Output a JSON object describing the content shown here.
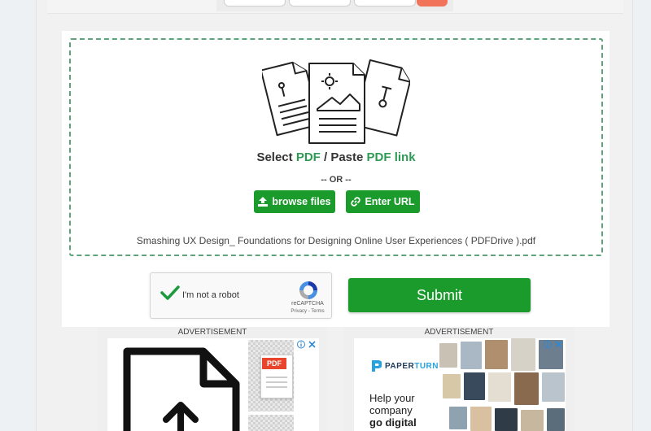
{
  "upload": {
    "title_select": "Select",
    "title_pdf1": "PDF",
    "title_sep": "/ Paste",
    "title_pdf2": "PDF link",
    "or_text": "-- OR --",
    "browse_label": "browse files",
    "url_label": "Enter URL",
    "filename": "Smashing UX Design_ Foundations for Designing Online User Experiences ( PDFDrive ).pdf"
  },
  "captcha": {
    "label": "I'm not a robot",
    "brand": "reCAPTCHA",
    "links": "Privacy - Terms"
  },
  "submit_label": "Submit",
  "ads": {
    "left_label": "ADVERTISEMENT",
    "right_label": "ADVERTISEMENT",
    "left_pdf_badge": "PDF",
    "right_brand_main": "PAPER",
    "right_brand_accent": "TURN",
    "right_tag_line1": "Help your",
    "right_tag_line2": "company",
    "right_tag_line3": "go digital"
  },
  "colors": {
    "accent_green": "#1a9b2c",
    "link_green": "#2e9a54",
    "dashed_border": "#5fa37b"
  }
}
